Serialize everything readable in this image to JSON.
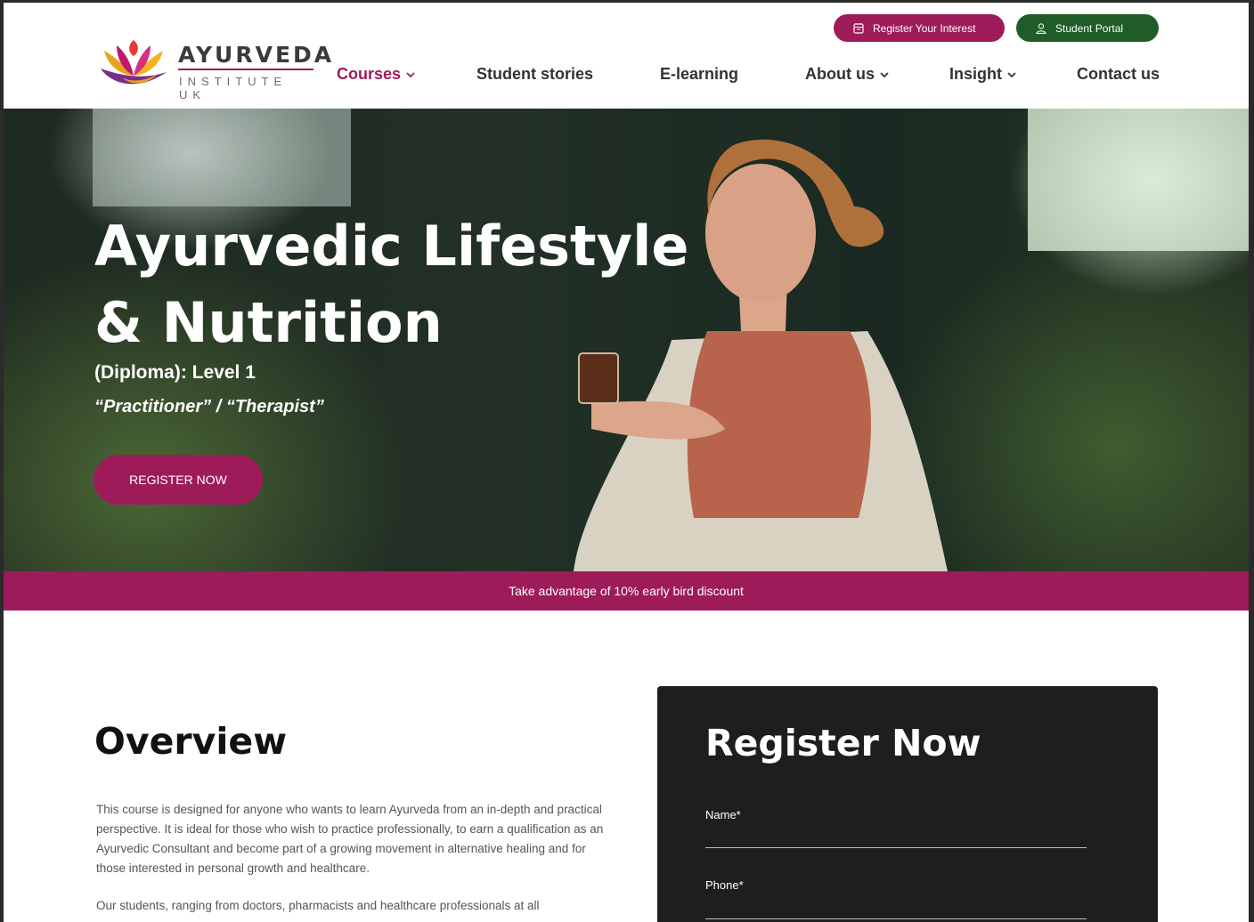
{
  "header": {
    "register_interest": "Register Your Interest",
    "student_portal": "Student Portal",
    "logo": {
      "word": "AYURVEDA",
      "sub": "INSTITUTE UK"
    },
    "nav": [
      {
        "label": "Courses",
        "dropdown": true,
        "active": true
      },
      {
        "label": "Student stories",
        "dropdown": false
      },
      {
        "label": "E-learning",
        "dropdown": false
      },
      {
        "label": "About us",
        "dropdown": true
      },
      {
        "label": "Insight",
        "dropdown": true
      },
      {
        "label": "Contact us",
        "dropdown": false
      }
    ]
  },
  "hero": {
    "title": "Ayurvedic Lifestyle & Nutrition",
    "subtitle": "(Diploma): Level 1",
    "tagline": "“Practitioner” / “Therapist”",
    "cta": "REGISTER NOW"
  },
  "banner": {
    "text": "Take advantage of 10% early bird discount"
  },
  "overview": {
    "title": "Overview",
    "paragraph1": "This course is designed for anyone who wants to learn Ayurveda from an in-depth and practical perspective. It is ideal for those who wish to practice professionally, to earn a qualification as an Ayurvedic Consultant and become part of a growing movement in alternative healing and for those interested in personal growth and healthcare.",
    "paragraph2": "Our students, ranging from doctors, pharmacists and healthcare professionals at all"
  },
  "form": {
    "title": "Register Now",
    "name_label": "Name*",
    "phone_label": "Phone*"
  },
  "colors": {
    "brand": "#9e1b5a",
    "portal_green": "#1f5c27",
    "form_bg": "#1e1e1e"
  },
  "icons": {
    "register_interest": "calendar-icon",
    "student_portal": "user-icon",
    "dropdown": "chevron-down-icon"
  }
}
